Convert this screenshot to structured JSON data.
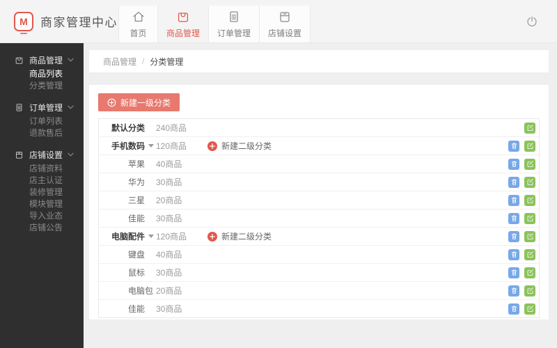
{
  "colors": {
    "accent_red": "#e2574c",
    "button_red": "#e8796e",
    "icon_blue": "#77a8e9",
    "icon_green": "#8bc35b",
    "sidebar_bg": "#2f2f2f",
    "header_bg": "#f4f4f4",
    "page_bg": "#efefef"
  },
  "header": {
    "brand_title": "商家管理中心",
    "logo_letter": "M",
    "tabs": [
      {
        "label": "首页",
        "icon": "home-icon",
        "active": false
      },
      {
        "label": "商品管理",
        "icon": "goods-bag-icon",
        "active": true
      },
      {
        "label": "订单管理",
        "icon": "order-clipboard-icon",
        "active": false
      },
      {
        "label": "店铺设置",
        "icon": "shop-box-icon",
        "active": false
      }
    ],
    "logout_icon": "power-icon"
  },
  "sidebar": {
    "groups": [
      {
        "label": "商品管理",
        "icon": "goods-bag-icon",
        "children": [
          {
            "label": "商品列表",
            "active": true
          },
          {
            "label": "分类管理",
            "active": false
          }
        ]
      },
      {
        "label": "订单管理",
        "icon": "order-clipboard-icon",
        "children": [
          {
            "label": "订单列表",
            "active": false
          },
          {
            "label": "退款售后",
            "active": false
          }
        ]
      },
      {
        "label": "店铺设置",
        "icon": "shop-box-icon",
        "children": [
          {
            "label": "店铺资料",
            "active": false
          },
          {
            "label": "店主认证",
            "active": false
          },
          {
            "label": "装修管理",
            "active": false
          },
          {
            "label": "模块管理",
            "active": false
          },
          {
            "label": "导入业态",
            "active": false
          },
          {
            "label": "店铺公告",
            "active": false
          }
        ]
      }
    ]
  },
  "breadcrumb": {
    "parent": "商品管理",
    "separator": "/",
    "current": "分类管理"
  },
  "content": {
    "new_top_category_button": "新建一级分类",
    "new_sub_category_label": "新建二级分类",
    "rows": [
      {
        "name": "默认分类",
        "count": "240商品",
        "level": 1,
        "caret": false,
        "add_sub": false,
        "deletable": false
      },
      {
        "name": "手机数码",
        "count": "120商品",
        "level": 1,
        "caret": true,
        "add_sub": true,
        "deletable": true
      },
      {
        "name": "苹果",
        "count": "40商品",
        "level": 2,
        "deletable": true
      },
      {
        "name": "华为",
        "count": "30商品",
        "level": 2,
        "deletable": true
      },
      {
        "name": "三星",
        "count": "20商品",
        "level": 2,
        "deletable": true
      },
      {
        "name": "佳能",
        "count": "30商品",
        "level": 2,
        "deletable": true
      },
      {
        "name": "电脑配件",
        "count": "120商品",
        "level": 1,
        "caret": true,
        "add_sub": true,
        "deletable": true
      },
      {
        "name": "键盘",
        "count": "40商品",
        "level": 2,
        "deletable": true
      },
      {
        "name": "鼠标",
        "count": "30商品",
        "level": 2,
        "deletable": true
      },
      {
        "name": "电脑包",
        "count": "20商品",
        "level": 2,
        "deletable": true
      },
      {
        "name": "佳能",
        "count": "30商品",
        "level": 2,
        "deletable": true
      }
    ]
  }
}
